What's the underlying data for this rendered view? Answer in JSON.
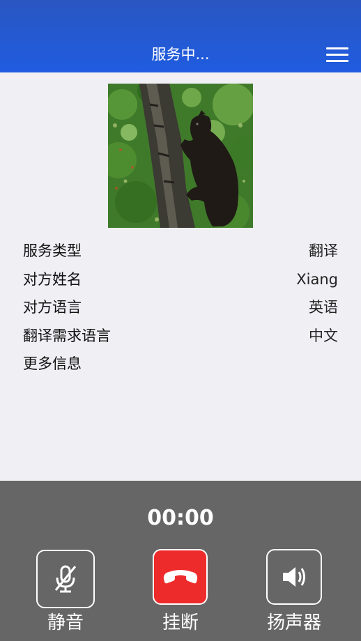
{
  "header": {
    "title": "服务中...",
    "menu_icon": "menu-icon"
  },
  "photo": {
    "subject": "bear-climbing-tree"
  },
  "info": {
    "rows": [
      {
        "label": "服务类型",
        "value": "翻译"
      },
      {
        "label": "对方姓名",
        "value": "Xiang"
      },
      {
        "label": "对方语言",
        "value": "英语"
      },
      {
        "label": "翻译需求语言",
        "value": "中文"
      },
      {
        "label": "更多信息",
        "value": ""
      }
    ]
  },
  "call": {
    "timer": "00:00",
    "mute": {
      "label": "静音",
      "icon": "mic-off-icon"
    },
    "hangup": {
      "label": "挂断",
      "icon": "phone-hangup-icon",
      "color": "#ee2b2b"
    },
    "speaker": {
      "label": "扬声器",
      "icon": "speaker-icon"
    }
  },
  "colors": {
    "header": "#1f5ce0",
    "background": "#efeff4",
    "panel": "#666666"
  }
}
